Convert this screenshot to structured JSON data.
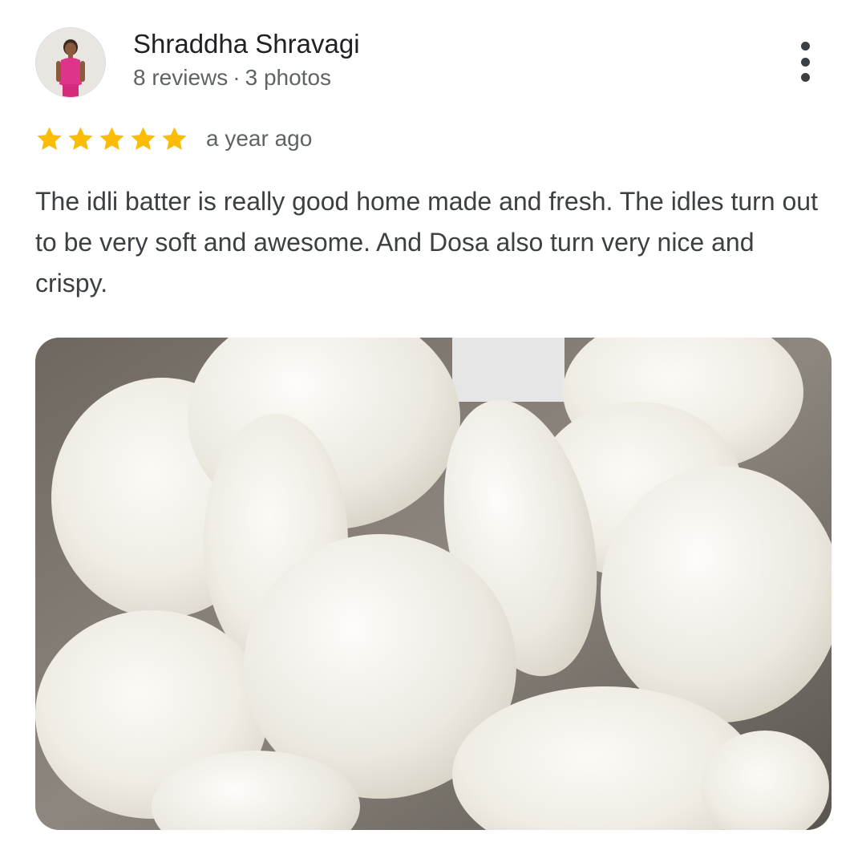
{
  "review": {
    "author_name": "Shraddha Shravagi",
    "reviews_count": "8 reviews",
    "separator": "·",
    "photos_count": "3 photos",
    "rating": 5,
    "rating_max": 5,
    "time_ago": "a year ago",
    "text": "The idli batter is really good home made and fresh. The idles turn out to be very soft and awesome. And Dosa also turn very nice and crispy.",
    "more_icon": "more-vert-icon",
    "star_icon": "star-icon",
    "photo_subject": "idli"
  },
  "colors": {
    "star": "#fbbc04",
    "name": "#202124",
    "secondary_text": "#5f6368",
    "body_text": "#3c4043",
    "menu_dots": "#3c4043"
  }
}
